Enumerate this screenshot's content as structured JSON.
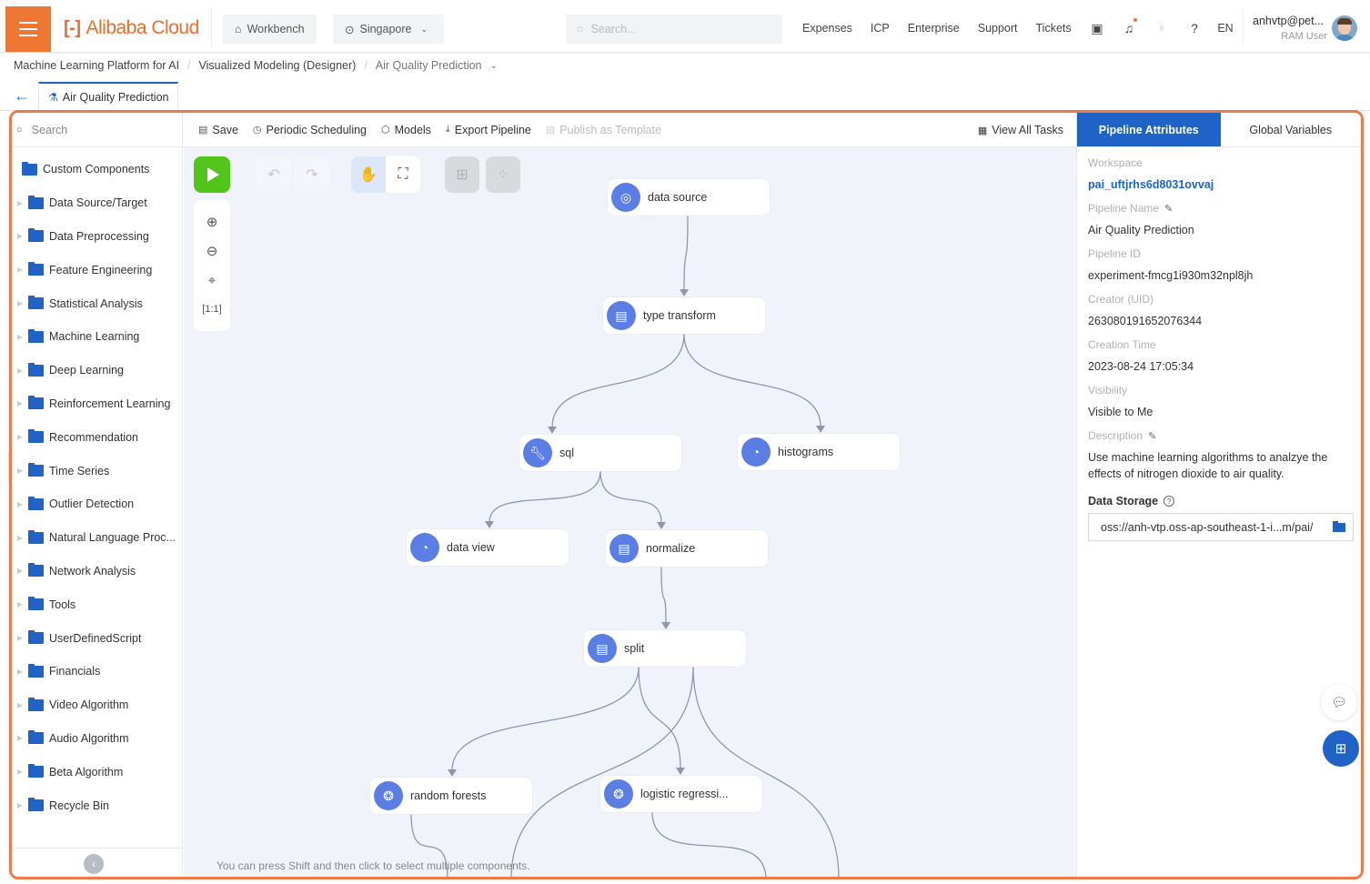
{
  "topbar": {
    "brand": "Alibaba Cloud",
    "workbench_label": "Workbench",
    "region_label": "Singapore",
    "search_placeholder": "Search...",
    "links": [
      "Expenses",
      "ICP",
      "Enterprise",
      "Support",
      "Tickets"
    ],
    "lang": "EN",
    "user_name": "anhvtp@pet...",
    "user_role": "RAM User"
  },
  "breadcrumb": [
    "Machine Learning Platform for AI",
    "Visualized Modeling (Designer)",
    "Air Quality Prediction"
  ],
  "doc_tab": {
    "label": "Air Quality Prediction"
  },
  "left": {
    "search_placeholder": "Search",
    "root": "Custom Components",
    "folders": [
      "Data Source/Target",
      "Data Preprocessing",
      "Feature Engineering",
      "Statistical Analysis",
      "Machine Learning",
      "Deep Learning",
      "Reinforcement Learning",
      "Recommendation",
      "Time Series",
      "Outlier Detection",
      "Natural Language Proc...",
      "Network Analysis",
      "Tools",
      "UserDefinedScript",
      "Financials",
      "Video Algorithm",
      "Audio Algorithm",
      "Beta Algorithm",
      "Recycle Bin"
    ]
  },
  "toolbar": {
    "save": "Save",
    "scheduling": "Periodic Scheduling",
    "models": "Models",
    "export": "Export Pipeline",
    "publish": "Publish as Template",
    "view_tasks": "View All Tasks"
  },
  "pipeline": {
    "nodes": [
      {
        "id": "ds",
        "label": "data source",
        "icon": "target"
      },
      {
        "id": "tt",
        "label": "type transform",
        "icon": "table"
      },
      {
        "id": "sql",
        "label": "sql",
        "icon": "wrench"
      },
      {
        "id": "hist",
        "label": "histograms",
        "icon": "pie"
      },
      {
        "id": "dv",
        "label": "data view",
        "icon": "pie"
      },
      {
        "id": "norm",
        "label": "normalize",
        "icon": "table"
      },
      {
        "id": "split",
        "label": "split",
        "icon": "table"
      },
      {
        "id": "rf",
        "label": "random forests",
        "icon": "brain"
      },
      {
        "id": "lr",
        "label": "logistic regressi...",
        "icon": "brain"
      }
    ],
    "edges": [
      [
        "ds",
        "tt"
      ],
      [
        "tt",
        "sql"
      ],
      [
        "tt",
        "hist"
      ],
      [
        "sql",
        "dv"
      ],
      [
        "sql",
        "norm"
      ],
      [
        "norm",
        "split"
      ],
      [
        "split",
        "rf"
      ],
      [
        "split",
        "lr"
      ]
    ],
    "hint": "You can press Shift and then click to select multiple components."
  },
  "right": {
    "tabs": [
      "Pipeline Attributes",
      "Global Variables"
    ],
    "fields": {
      "workspace_label": "Workspace",
      "workspace": "pai_uftjrhs6d8031ovvaj",
      "name_label": "Pipeline Name",
      "name": "Air Quality Prediction",
      "id_label": "Pipeline ID",
      "id": "experiment-fmcg1i930m32npl8jh",
      "creator_label": "Creator (UID)",
      "creator": "263080191652076344",
      "time_label": "Creation Time",
      "time": "2023-08-24 17:05:34",
      "visibility_label": "Visibility",
      "visibility": "Visible to Me",
      "desc_label": "Description",
      "desc": "Use machine learning algorithms to analzye the effects of nitrogen dioxide to air quality.",
      "storage_label": "Data Storage",
      "storage": "oss://anh-vtp.oss-ap-southeast-1-i...m/pai/"
    }
  },
  "colors": {
    "brand": "#ee7734",
    "accent": "#1e63c5",
    "node_icon": "#5b7ee5",
    "run": "#52c41a",
    "highlight_frame": "#ee7a4b"
  }
}
